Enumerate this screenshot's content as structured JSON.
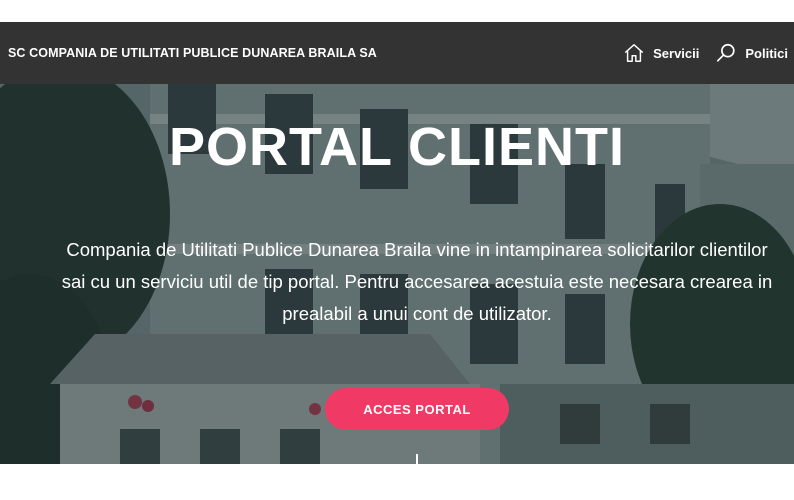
{
  "navbar": {
    "brand": "SC COMPANIA DE UTILITATI PUBLICE DUNAREA BRAILA SA",
    "links": [
      {
        "label": "Servicii",
        "icon": "home-icon"
      },
      {
        "label": "Politici",
        "icon": "search-icon"
      }
    ]
  },
  "hero": {
    "title": "PORTAL CLIENTI",
    "description": "Compania de Utilitati Publice Dunarea Braila vine in intampinarea solicitarilor clientilor sai cu un serviciu util de tip portal. Pentru accesarea acestuia este necesara crearea in prealabil a unui cont de utilizator.",
    "button_label": "ACCES PORTAL"
  },
  "colors": {
    "navbar_bg": "#333333",
    "accent": "#f03a65",
    "text": "#ffffff"
  }
}
